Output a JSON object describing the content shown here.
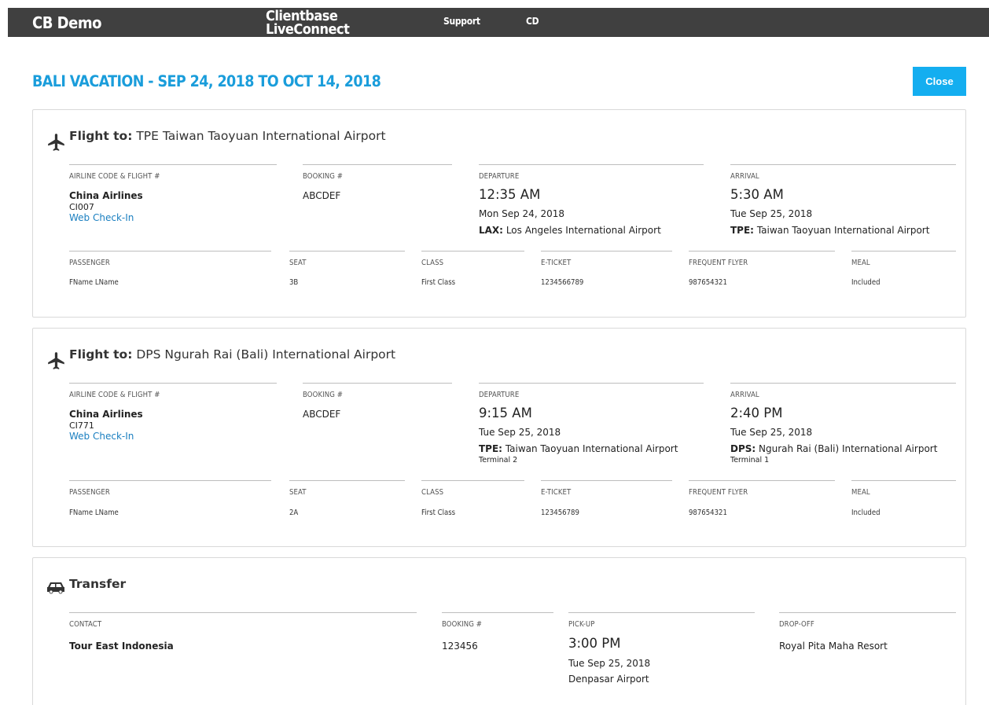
{
  "topbar": {
    "brand": "CB Demo",
    "product_line1": "Clientbase",
    "product_line2": "LiveConnect",
    "nav_support": "Support",
    "nav_user": "CD"
  },
  "page": {
    "title": "BALI VACATION - SEP 24, 2018 TO OCT 14, 2018",
    "close_label": "Close"
  },
  "flight1": {
    "icon": "airplane-icon",
    "title_prefix": "Flight to:",
    "title": "TPE Taiwan Taoyuan International Airport",
    "labels": {
      "airline": "AIRLINE CODE & FLIGHT #",
      "booking": "BOOKING #",
      "departure": "DEPARTURE",
      "arrival": "ARRIVAL"
    },
    "airline": "China Airlines",
    "flight_no": "CI007",
    "checkin": "Web Check-In",
    "booking": "ABCDEF",
    "dep_time": "12:35 AM",
    "dep_date": "Mon Sep 24, 2018",
    "dep_code": "LAX:",
    "dep_airport": "Los Angeles International Airport",
    "arr_time": "5:30 AM",
    "arr_date": "Tue Sep 25, 2018",
    "arr_code": "TPE:",
    "arr_airport": "Taiwan Taoyuan International Airport",
    "pax_labels": {
      "passenger": "PASSENGER",
      "seat": "SEAT",
      "class": "CLASS",
      "eticket": "E-TICKET",
      "ff": "FREQUENT FLYER",
      "meal": "MEAL"
    },
    "passenger": {
      "name": "FName LName",
      "seat": "3B",
      "class": "First Class",
      "eticket": "1234566789",
      "ff": "987654321",
      "meal": "Included"
    }
  },
  "flight2": {
    "icon": "airplane-icon",
    "title_prefix": "Flight to:",
    "title": "DPS Ngurah Rai (Bali) International Airport",
    "labels": {
      "airline": "AIRLINE CODE & FLIGHT #",
      "booking": "BOOKING #",
      "departure": "DEPARTURE",
      "arrival": "ARRIVAL"
    },
    "airline": "China Airlines",
    "flight_no": "CI771",
    "checkin": "Web Check-In",
    "booking": "ABCDEF",
    "dep_time": "9:15 AM",
    "dep_date": "Tue Sep 25, 2018",
    "dep_code": "TPE:",
    "dep_airport": "Taiwan Taoyuan International Airport",
    "dep_terminal": "Terminal 2",
    "arr_time": "2:40 PM",
    "arr_date": "Tue Sep 25, 2018",
    "arr_code": "DPS:",
    "arr_airport": "Ngurah Rai (Bali) International Airport",
    "arr_terminal": "Terminal 1",
    "pax_labels": {
      "passenger": "PASSENGER",
      "seat": "SEAT",
      "class": "CLASS",
      "eticket": "E-TICKET",
      "ff": "FREQUENT FLYER",
      "meal": "MEAL"
    },
    "passenger": {
      "name": "FName LName",
      "seat": "2A",
      "class": "First Class",
      "eticket": "123456789",
      "ff": "987654321",
      "meal": "Included"
    }
  },
  "transfer": {
    "icon": "car-icon",
    "title": "Transfer",
    "labels": {
      "contact": "CONTACT",
      "booking": "BOOKING #",
      "pickup": "PICK-UP",
      "dropoff": "DROP-OFF"
    },
    "contact": "Tour East Indonesia",
    "booking": "123456",
    "pickup_time": "3:00 PM",
    "pickup_date": "Tue Sep 25, 2018",
    "pickup_place": "Denpasar Airport",
    "dropoff": "Royal Pita Maha Resort"
  }
}
